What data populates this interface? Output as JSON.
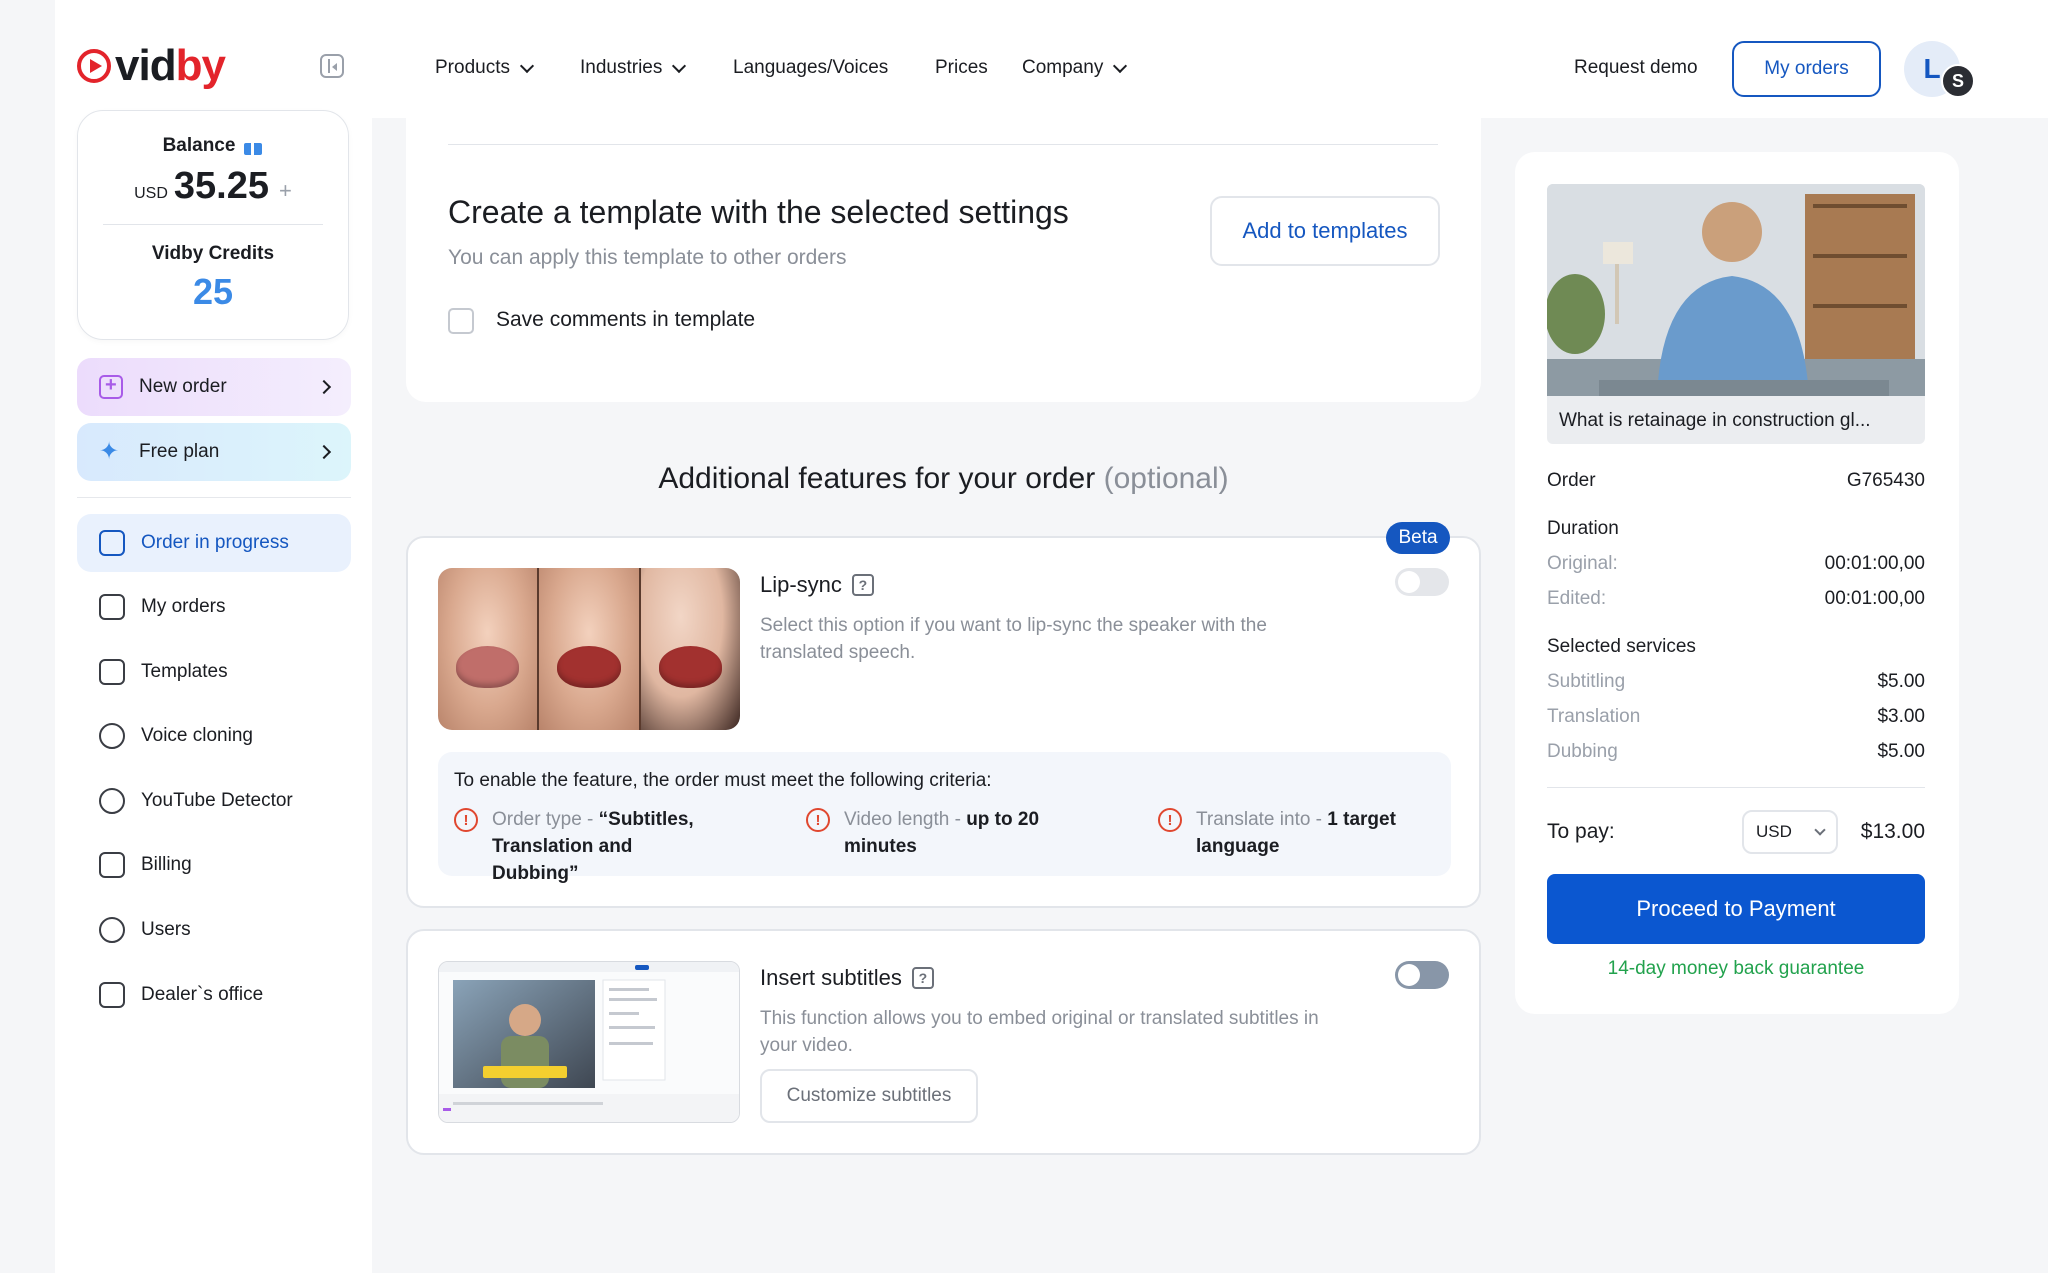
{
  "brand": {
    "logo_a": "vid",
    "logo_b": "by",
    "accent": "#e3242b",
    "primary": "#1557c0"
  },
  "balance": {
    "label": "Balance",
    "currency": "USD",
    "amount": "35.25",
    "plus": "+",
    "credits_label": "Vidby Credits",
    "credits": "25"
  },
  "promo": {
    "new_order": "New order",
    "free_plan": "Free plan"
  },
  "sidebar": {
    "items": [
      {
        "label": "Order in progress",
        "icon": "edit-icon"
      },
      {
        "label": "My orders",
        "icon": "list-icon"
      },
      {
        "label": "Templates",
        "icon": "grid-icon"
      },
      {
        "label": "Voice cloning",
        "icon": "waveform-icon"
      },
      {
        "label": "YouTube Detector",
        "icon": "play-search-icon"
      },
      {
        "label": "Billing",
        "icon": "receipt-icon"
      },
      {
        "label": "Users",
        "icon": "users-icon"
      },
      {
        "label": "Dealer`s office",
        "icon": "briefcase-icon"
      }
    ]
  },
  "topnav": {
    "products": "Products",
    "industries": "Industries",
    "languages": "Languages/Voices",
    "prices": "Prices",
    "company": "Company",
    "request_demo": "Request demo",
    "my_orders": "My orders",
    "avatar": "L",
    "avatar_badge": "S"
  },
  "template": {
    "title": "Create a template with the selected settings",
    "subtitle": "You can apply this template to other orders",
    "add_button": "Add to templates",
    "checkbox_label": "Save comments in template"
  },
  "features": {
    "title": "Additional features for your order",
    "optional": "(optional)",
    "lipsync": {
      "badge": "Beta",
      "title": "Lip-sync",
      "help": "?",
      "desc": "Select this option if you want to lip-sync the speaker with the translated speech.",
      "enabled": false,
      "criteria_title": "To enable the feature, the order must meet the following criteria:",
      "criteria": [
        {
          "label": "Order type - ",
          "value": "“Subtitles, Translation and Dubbing”"
        },
        {
          "label": "Video length - ",
          "value": "up to 20 minutes"
        },
        {
          "label": "Translate into - ",
          "value": "1 target language"
        }
      ]
    },
    "subtitles": {
      "title": "Insert subtitles",
      "help": "?",
      "desc": "This function allows you to embed original or translated subtitles in your video.",
      "button": "Customize subtitles",
      "enabled": false
    }
  },
  "summary": {
    "video_title": "What is retainage in construction gl...",
    "order_label": "Order",
    "order_id": "G765430",
    "duration_label": "Duration",
    "original_label": "Original:",
    "original": "00:01:00,00",
    "edited_label": "Edited:",
    "edited": "00:01:00,00",
    "services_label": "Selected services",
    "services": [
      {
        "name": "Subtitling",
        "price": "$5.00"
      },
      {
        "name": "Translation",
        "price": "$3.00"
      },
      {
        "name": "Dubbing",
        "price": "$5.00"
      }
    ],
    "to_pay_label": "To pay:",
    "currency": "USD",
    "total": "$13.00",
    "pay_button": "Proceed to Payment",
    "guarantee": "14-day money back guarantee"
  }
}
